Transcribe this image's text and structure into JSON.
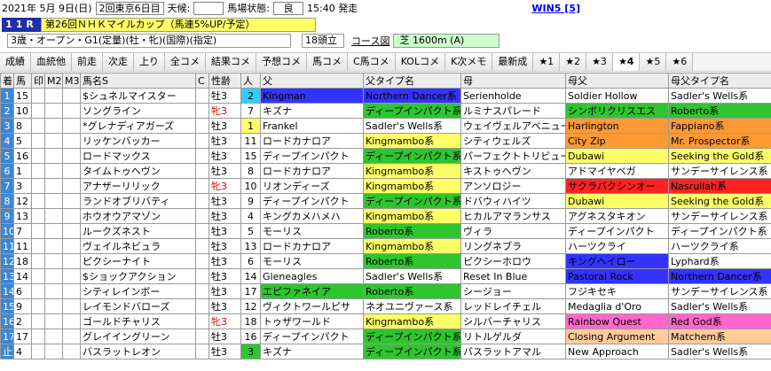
{
  "header": {
    "date": "2021年 5月 9日(日)",
    "meeting": "2回東京6日目",
    "weather_label": "天候:",
    "weather_value": "",
    "track_label": "馬場状態:",
    "track_value": "良",
    "post_time": "15:40 発走",
    "win5": "WIN5 [5]"
  },
  "race": {
    "number": "11R",
    "name": "第26回ＮＨＫマイルカップ（馬連5%UP/予定）",
    "conditions": "3歳・オープン・G1(定量)(牡・牝)(国際)(指定)",
    "heads": "18頭立",
    "course_link": "コース図",
    "surface": "芝 1600m (A)"
  },
  "toolbar": [
    {
      "label": "成績",
      "active": false
    },
    {
      "label": "血統他",
      "active": false
    },
    {
      "label": "前走",
      "active": false
    },
    {
      "label": "次走",
      "active": false
    },
    {
      "label": "上り",
      "active": false
    },
    {
      "label": "全コメ",
      "active": false
    },
    {
      "label": "結果コメ",
      "active": false
    },
    {
      "label": "予想コメ",
      "active": false
    },
    {
      "label": "馬コメ",
      "active": false
    },
    {
      "label": "C馬コメ",
      "active": false
    },
    {
      "label": "KOLコメ",
      "active": false
    },
    {
      "label": "K次メモ",
      "active": false
    },
    {
      "label": "最新成",
      "active": false
    },
    {
      "label": "★1",
      "active": false
    },
    {
      "label": "★2",
      "active": false
    },
    {
      "label": "★3",
      "active": false
    },
    {
      "label": "★4",
      "active": true
    },
    {
      "label": "★5",
      "active": false
    },
    {
      "label": "★6",
      "active": false
    }
  ],
  "columns": [
    "着",
    "馬",
    "印",
    "M2",
    "M3",
    "馬名S",
    "C",
    "性齢",
    "人",
    "父",
    "父タイプ名",
    "母",
    "母父",
    "母父タイプ名"
  ],
  "colors": {
    "waku": [
      "#ffffff",
      "#ffffff",
      "#222222",
      "#e8262a",
      "#1e5bd6",
      "#f2e52b",
      "#2c9c3c",
      "#f58a1e",
      "#f28fb7"
    ],
    "green": "#2ec52e",
    "light_green": "#99ff99",
    "yellow": "#ffff66",
    "orange": "#ff9933",
    "cyan": "#33ccff",
    "blue": "#3333ff",
    "red": "#ff2222",
    "pink": "#ff66cc",
    "peach": "#ffcc99",
    "lime": "#ccff33"
  },
  "horses": [
    {
      "chaku": "1",
      "uma": "15",
      "waku": 7,
      "mark": "",
      "m2": "",
      "m3": "",
      "name": "$シュネルマイスター",
      "c": "",
      "sex": "牡3",
      "ninki": "2",
      "ninki_bg": "#33ccff",
      "sire": "Kingman",
      "sire_bg": "#3333ff",
      "sire_color": "#000",
      "sire_type": "Northern Dancer系",
      "st_bg": "#3333ff",
      "dam": "Serienholde",
      "dam_bg": "#ffffff",
      "damsire": "Soldier Hollow",
      "ds_bg": "#ffffff",
      "ds_type": "Sadler's Wells系",
      "dst_bg": "#ffffff"
    },
    {
      "chaku": "2",
      "uma": "10",
      "waku": 5,
      "mark": "",
      "m2": "",
      "m3": "",
      "name": "ソングライン",
      "c": "",
      "sex": "牝3",
      "ninki": "7",
      "ninki_bg": "#ffffff",
      "sire": "キズナ",
      "sire_bg": "#ffffff",
      "sire_color": "#000",
      "sire_type": "ディープインパクト系",
      "st_bg": "#2ec52e",
      "dam": "ルミナスパレード",
      "dam_bg": "#ffffff",
      "damsire": "シンボリクリスエス",
      "ds_bg": "#2ec52e",
      "ds_type": "Roberto系",
      "dst_bg": "#2ec52e"
    },
    {
      "chaku": "3",
      "uma": "8",
      "waku": 4,
      "mark": "",
      "m2": "",
      "m3": "",
      "name": "*グレナディアガーズ",
      "c": "",
      "sex": "牡3",
      "ninki": "1",
      "ninki_bg": "#ffff66",
      "sire": "Frankel",
      "sire_bg": "#ffffff",
      "sire_color": "#000",
      "sire_type": "Sadler's Wells系",
      "st_bg": "#ffffff",
      "dam": "ウェイヴェルアベニュー",
      "dam_bg": "#ffffff",
      "damsire": "Harlington",
      "ds_bg": "#ff9933",
      "ds_type": "Fappiano系",
      "dst_bg": "#ff9933"
    },
    {
      "chaku": "4",
      "uma": "5",
      "waku": 3,
      "mark": "",
      "m2": "",
      "m3": "",
      "name": "リッケンバッカー",
      "c": "",
      "sex": "牡3",
      "ninki": "11",
      "ninki_bg": "#ffffff",
      "sire": "ロードカナロア",
      "sire_bg": "#ffffff",
      "sire_color": "#000",
      "sire_type": "Kingmambo系",
      "st_bg": "#ffff66",
      "dam": "シティウェルズ",
      "dam_bg": "#ffffff",
      "damsire": "City Zip",
      "ds_bg": "#ff9933",
      "ds_type": "Mr. Prospector系",
      "dst_bg": "#ff9933"
    },
    {
      "chaku": "5",
      "uma": "16",
      "waku": 8,
      "mark": "",
      "m2": "",
      "m3": "",
      "name": "ロードマックス",
      "c": "",
      "sex": "牡3",
      "ninki": "15",
      "ninki_bg": "#ffffff",
      "sire": "ディープインパクト",
      "sire_bg": "#ffffff",
      "sire_color": "#000",
      "sire_type": "ディープインパクト系",
      "st_bg": "#2ec52e",
      "dam": "パーフェクトトリビュート",
      "dam_bg": "#ffffff",
      "damsire": "Dubawi",
      "ds_bg": "#ffff66",
      "ds_type": "Seeking the Gold系",
      "dst_bg": "#ffff66"
    },
    {
      "chaku": "6",
      "uma": "1",
      "waku": 1,
      "mark": "",
      "m2": "",
      "m3": "",
      "name": "タイムトゥヘヴン",
      "c": "",
      "sex": "牡3",
      "ninki": "8",
      "ninki_bg": "#ffffff",
      "sire": "ロードカナロア",
      "sire_bg": "#ffffff",
      "sire_color": "#000",
      "sire_type": "Kingmambo系",
      "st_bg": "#ffff66",
      "dam": "キストゥヘヴン",
      "dam_bg": "#ffffff",
      "damsire": "アドマイヤベガ",
      "ds_bg": "#ffffff",
      "ds_type": "サンデーサイレンス系",
      "dst_bg": "#ffffff"
    },
    {
      "chaku": "7",
      "uma": "3",
      "waku": 2,
      "mark": "",
      "m2": "",
      "m3": "",
      "name": "アナザーリリック",
      "c": "",
      "sex": "牝3",
      "ninki": "10",
      "ninki_bg": "#ffffff",
      "sire": "リオンディーズ",
      "sire_bg": "#ffffff",
      "sire_color": "#000",
      "sire_type": "Kingmambo系",
      "st_bg": "#ffff66",
      "dam": "アンソロジー",
      "dam_bg": "#ffffff",
      "damsire": "サクラバクシンオー",
      "ds_bg": "#ff2222",
      "ds_type": "Nasrullah系",
      "dst_bg": "#ff2222"
    },
    {
      "chaku": "8",
      "uma": "12",
      "waku": 6,
      "mark": "",
      "m2": "",
      "m3": "",
      "name": "ランドオブリバティ",
      "c": "",
      "sex": "牡3",
      "ninki": "9",
      "ninki_bg": "#ffffff",
      "sire": "ディープインパクト",
      "sire_bg": "#ffffff",
      "sire_color": "#000",
      "sire_type": "ディープインパクト系",
      "st_bg": "#2ec52e",
      "dam": "ドバウィハイツ",
      "dam_bg": "#ffffff",
      "damsire": "Dubawi",
      "ds_bg": "#ffff66",
      "ds_type": "Seeking the Gold系",
      "dst_bg": "#ffff66"
    },
    {
      "chaku": "9",
      "uma": "13",
      "waku": 7,
      "mark": "",
      "m2": "",
      "m3": "",
      "name": "ホウオウアマゾン",
      "c": "",
      "sex": "牡3",
      "ninki": "4",
      "ninki_bg": "#ffffff",
      "sire": "キングカメハメハ",
      "sire_bg": "#ffffff",
      "sire_color": "#000",
      "sire_type": "Kingmambo系",
      "st_bg": "#ffff66",
      "dam": "ヒカルアマランサス",
      "dam_bg": "#ffffff",
      "damsire": "アグネスタキオン",
      "ds_bg": "#ffffff",
      "ds_type": "サンデーサイレンス系",
      "dst_bg": "#ffffff"
    },
    {
      "chaku": "10",
      "uma": "7",
      "waku": 4,
      "mark": "",
      "m2": "",
      "m3": "",
      "name": "ルークズネスト",
      "c": "",
      "sex": "牡3",
      "ninki": "5",
      "ninki_bg": "#ffffff",
      "sire": "モーリス",
      "sire_bg": "#ffffff",
      "sire_color": "#000",
      "sire_type": "Roberto系",
      "st_bg": "#2ec52e",
      "dam": "ヴィラ",
      "dam_bg": "#ffffff",
      "damsire": "ディープインパクト",
      "ds_bg": "#ffffff",
      "ds_type": "ディープインパクト系",
      "dst_bg": "#ffffff"
    },
    {
      "chaku": "11",
      "uma": "11",
      "waku": 6,
      "mark": "",
      "m2": "",
      "m3": "",
      "name": "ヴェイルネビュラ",
      "c": "",
      "sex": "牡3",
      "ninki": "13",
      "ninki_bg": "#ffffff",
      "sire": "ロードカナロア",
      "sire_bg": "#ffffff",
      "sire_color": "#000",
      "sire_type": "Kingmambo系",
      "st_bg": "#ffff66",
      "dam": "リングネブラ",
      "dam_bg": "#ffffff",
      "damsire": "ハーツクライ",
      "ds_bg": "#ffffff",
      "ds_type": "ハーツクライ系",
      "dst_bg": "#ffffff"
    },
    {
      "chaku": "12",
      "uma": "18",
      "waku": 8,
      "mark": "",
      "m2": "",
      "m3": "",
      "name": "ピクシーナイト",
      "c": "",
      "sex": "牡3",
      "ninki": "6",
      "ninki_bg": "#ffffff",
      "sire": "モーリス",
      "sire_bg": "#ffffff",
      "sire_color": "#000",
      "sire_type": "Roberto系",
      "st_bg": "#2ec52e",
      "dam": "ピクシーホロウ",
      "dam_bg": "#ffffff",
      "damsire": "キングヘイロー",
      "ds_bg": "#3333ff",
      "ds_type": "Lyphard系",
      "dst_bg": "#ffffff"
    },
    {
      "chaku": "13",
      "uma": "14",
      "waku": 7,
      "mark": "",
      "m2": "",
      "m3": "",
      "name": "$ショックアクション",
      "c": "",
      "sex": "牡3",
      "ninki": "14",
      "ninki_bg": "#ffffff",
      "sire": "Gleneagles",
      "sire_bg": "#ffffff",
      "sire_color": "#000",
      "sire_type": "Sadler's Wells系",
      "st_bg": "#ffffff",
      "dam": "Reset In Blue",
      "dam_bg": "#ffffff",
      "damsire": "Pastoral Rock",
      "ds_bg": "#3333ff",
      "ds_type": "Northern Dancer系",
      "dst_bg": "#3333ff"
    },
    {
      "chaku": "14",
      "uma": "6",
      "waku": 3,
      "mark": "",
      "m2": "",
      "m3": "",
      "name": "シティレインボー",
      "c": "",
      "sex": "牡3",
      "ninki": "17",
      "ninki_bg": "#ffffff",
      "sire": "エピファネイア",
      "sire_bg": "#2ec52e",
      "sire_color": "#000",
      "sire_type": "Roberto系",
      "st_bg": "#2ec52e",
      "dam": "シージョー",
      "dam_bg": "#ffffff",
      "damsire": "フジキセキ",
      "ds_bg": "#ffffff",
      "ds_type": "サンデーサイレンス系",
      "dst_bg": "#ffffff"
    },
    {
      "chaku": "15",
      "uma": "9",
      "waku": 5,
      "mark": "",
      "m2": "",
      "m3": "",
      "name": "レイモンドバローズ",
      "c": "",
      "sex": "牡3",
      "ninki": "12",
      "ninki_bg": "#ffffff",
      "sire": "ヴィクトワールピサ",
      "sire_bg": "#ffffff",
      "sire_color": "#000",
      "sire_type": "ネオユニヴァース系",
      "st_bg": "#ffffff",
      "dam": "レッドレイチェル",
      "dam_bg": "#ffffff",
      "damsire": "Medaglia d'Oro",
      "ds_bg": "#ffffff",
      "ds_type": "Sadler's Wells系",
      "dst_bg": "#ffffff"
    },
    {
      "chaku": "16",
      "uma": "2",
      "waku": 1,
      "mark": "",
      "m2": "",
      "m3": "",
      "name": "ゴールドチャリス",
      "c": "",
      "sex": "牝3",
      "ninki": "18",
      "ninki_bg": "#ffffff",
      "sire": "トゥザワールド",
      "sire_bg": "#ffffff",
      "sire_color": "#000",
      "sire_type": "Kingmambo系",
      "st_bg": "#ffff66",
      "dam": "シルバーチャリス",
      "dam_bg": "#ffffff",
      "damsire": "Rainbow Quest",
      "ds_bg": "#ff66cc",
      "ds_type": "Red God系",
      "dst_bg": "#ff66cc"
    },
    {
      "chaku": "17",
      "uma": "17",
      "waku": 8,
      "mark": "",
      "m2": "",
      "m3": "",
      "name": "グレイイングリーン",
      "c": "",
      "sex": "牡3",
      "ninki": "16",
      "ninki_bg": "#ffffff",
      "sire": "ディープインパクト",
      "sire_bg": "#ffffff",
      "sire_color": "#000",
      "sire_type": "ディープインパクト系",
      "st_bg": "#2ec52e",
      "dam": "リトルゲルダ",
      "dam_bg": "#ffffff",
      "damsire": "Closing Argument",
      "ds_bg": "#ffcc99",
      "ds_type": "Matchem系",
      "dst_bg": "#ffcc99"
    },
    {
      "chaku": "止",
      "uma": "4",
      "waku": 2,
      "mark": "",
      "m2": "",
      "m3": "",
      "name": "バスラットレオン",
      "c": "",
      "sex": "牡3",
      "ninki": "3",
      "ninki_bg": "#2ec52e",
      "sire": "キズナ",
      "sire_bg": "#ffffff",
      "sire_color": "#000",
      "sire_type": "ディープインパクト系",
      "st_bg": "#2ec52e",
      "dam": "バスラットアマル",
      "dam_bg": "#ffffff",
      "damsire": "New Approach",
      "ds_bg": "#ffffff",
      "ds_type": "Sadler's Wells系",
      "dst_bg": "#ffffff"
    }
  ]
}
